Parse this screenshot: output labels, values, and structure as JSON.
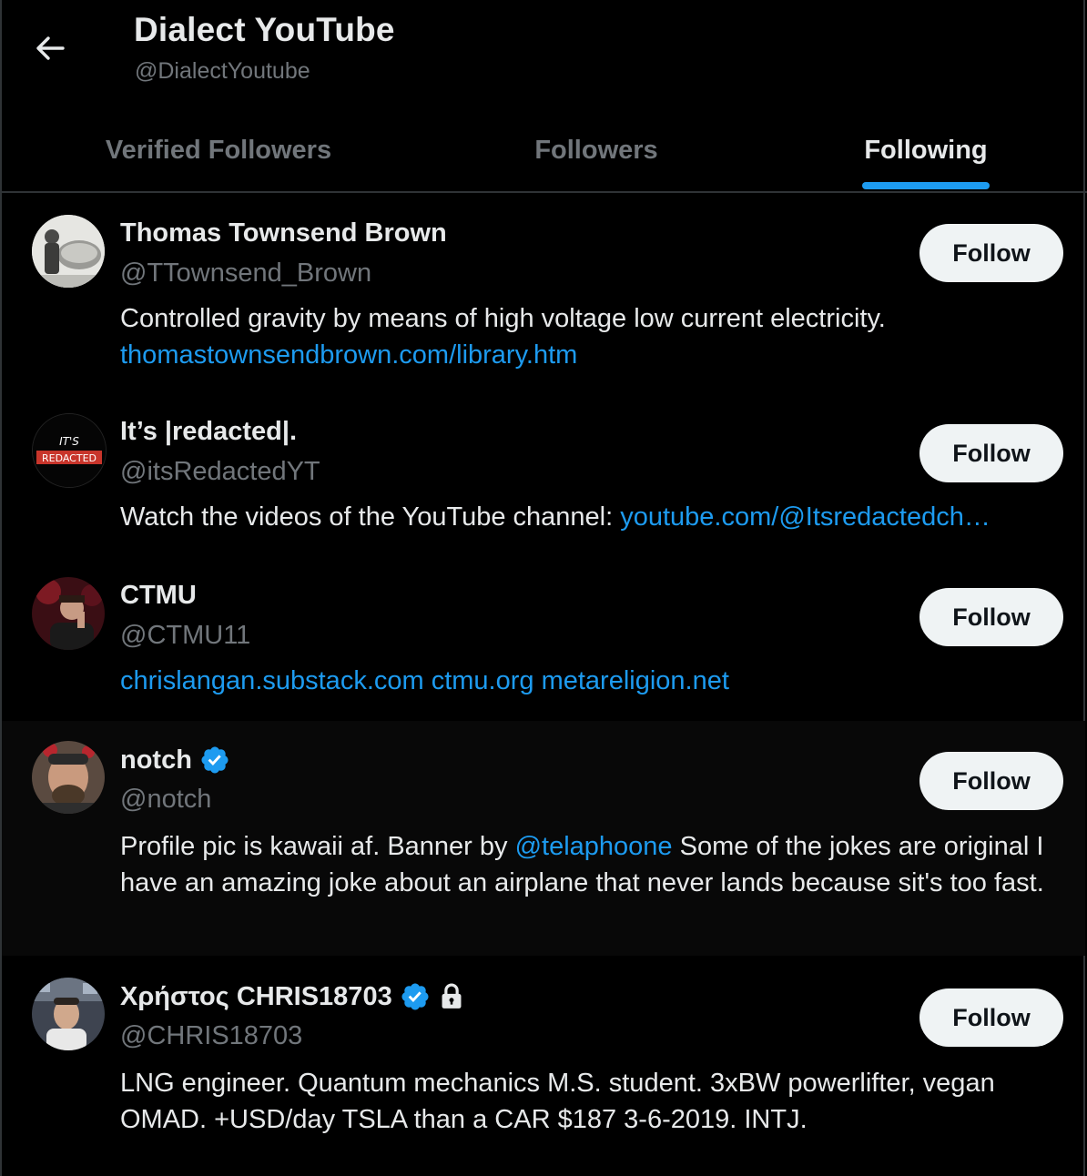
{
  "header": {
    "title": "Dialect YouTube",
    "handle": "@DialectYoutube",
    "back_icon": "arrow-left-icon"
  },
  "tabs": [
    {
      "label": "Verified Followers",
      "active": false
    },
    {
      "label": "Followers",
      "active": false
    },
    {
      "label": "Following",
      "active": true
    }
  ],
  "colors": {
    "background": "#000000",
    "accent": "#1d9bf0",
    "muted_text": "#71767b",
    "text": "#e7e9ea",
    "follow_button_bg": "#eff3f4"
  },
  "users": [
    {
      "name": "Thomas Townsend Brown",
      "handle": "@TTownsend_Brown",
      "verified": false,
      "protected": false,
      "bio_text": "Controlled gravity by means of high voltage low current electricity.",
      "bio_link": "thomastownsendbrown.com/library.htm",
      "follow_label": "Follow"
    },
    {
      "name": "It’s |redacted|.",
      "handle": "@itsRedactedYT",
      "verified": false,
      "protected": false,
      "avatar_text_top": "IT'S",
      "avatar_text_bottom": "REDACTED",
      "bio_text": "Watch the videos of the YouTube channel: ",
      "bio_link": "youtube.com/@Itsredactedch…",
      "follow_label": "Follow"
    },
    {
      "name": "CTMU",
      "handle": "@CTMU11",
      "verified": false,
      "protected": false,
      "bio_link": "chrislangan.substack.com ctmu.org metareligion.net",
      "follow_label": "Follow"
    },
    {
      "name": "notch",
      "handle": "@notch",
      "verified": true,
      "protected": false,
      "bio_before": "Profile pic is kawaii af. Banner by ",
      "bio_mention": "@telaphoone",
      "bio_after": " Some of the jokes are original I have an amazing joke about an airplane that never lands because sit's too fast.",
      "follow_label": "Follow"
    },
    {
      "name": "Χρήστος CHRIS18703",
      "handle": "@CHRIS18703",
      "verified": true,
      "protected": true,
      "bio_text": "LNG engineer. Quantum mechanics M.S. student. 3xBW powerlifter, vegan OMAD. +USD/day TSLA than a CAR $187 3-6-2019. INTJ.",
      "follow_label": "Follow"
    }
  ]
}
